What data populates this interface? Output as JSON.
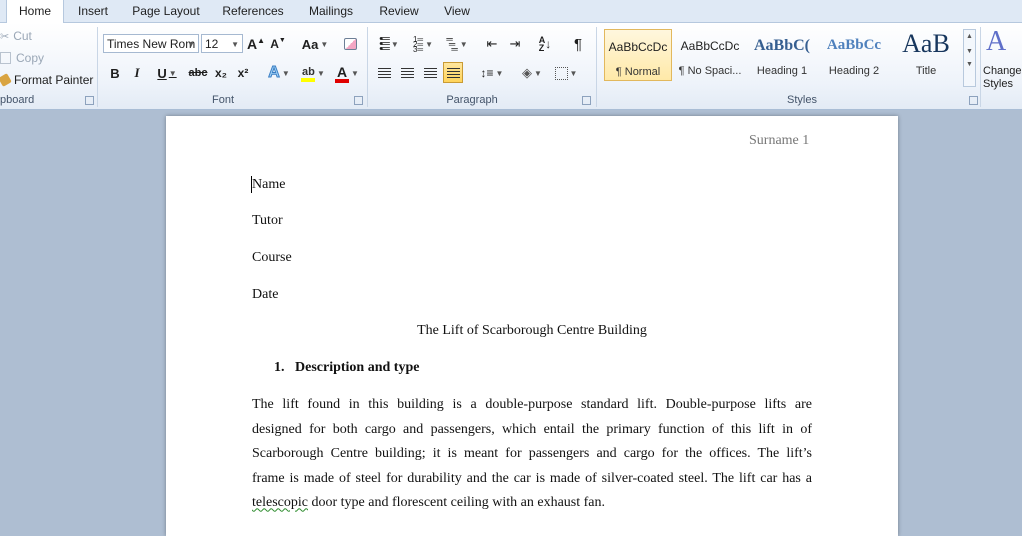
{
  "tabs": [
    "Home",
    "Insert",
    "Page Layout",
    "References",
    "Mailings",
    "Review",
    "View"
  ],
  "clipboard": {
    "cut": "Cut",
    "copy": "Copy",
    "format_painter": "Format Painter",
    "label": "pboard"
  },
  "font": {
    "name": "Times New Rom",
    "size": "12",
    "label": "Font",
    "grow": "A",
    "shrink": "A",
    "change_case": "Aa",
    "bold": "B",
    "italic": "I",
    "underline": "U",
    "strike": "abc",
    "subscript": "x₂",
    "superscript": "x²",
    "color_letter": "A",
    "highlight_color": "#ffff00",
    "font_color": "#e00000"
  },
  "paragraph": {
    "label": "Paragraph",
    "pilcrow": "¶"
  },
  "styles": {
    "label": "Styles",
    "items": [
      {
        "sample": "AaBbCcDc",
        "name": "¶ Normal"
      },
      {
        "sample": "AaBbCcDc",
        "name": "¶ No Spaci..."
      },
      {
        "sample": "AaBbC(",
        "name": "Heading 1"
      },
      {
        "sample": "AaBbCc",
        "name": "Heading 2"
      },
      {
        "sample": "AaB",
        "name": "Title"
      }
    ],
    "change_styles_line1": "Change",
    "change_styles_line2": "Styles"
  },
  "document": {
    "header": "Surname 1",
    "name": "Name",
    "tutor": "Tutor",
    "course": "Course",
    "date": "Date",
    "title": "The Lift of Scarborough Centre Building",
    "heading_number": "1.",
    "heading_text": "Description and type",
    "paragraph_lines": [
      "The lift found in this building is a double-purpose standard lift. Double-purpose lifts are",
      "designed for both cargo and passengers, which entail the primary function of this lift in of",
      "Scarborough Centre building; it is meant for passengers and cargo for the offices. The lift’s",
      "frame is made of steel for durability and the car is made of silver-coated steel. The lift car has a"
    ],
    "last_line_misspelled": "telescopic",
    "last_line_rest": " door type and florescent ceiling with an exhaust fan."
  }
}
